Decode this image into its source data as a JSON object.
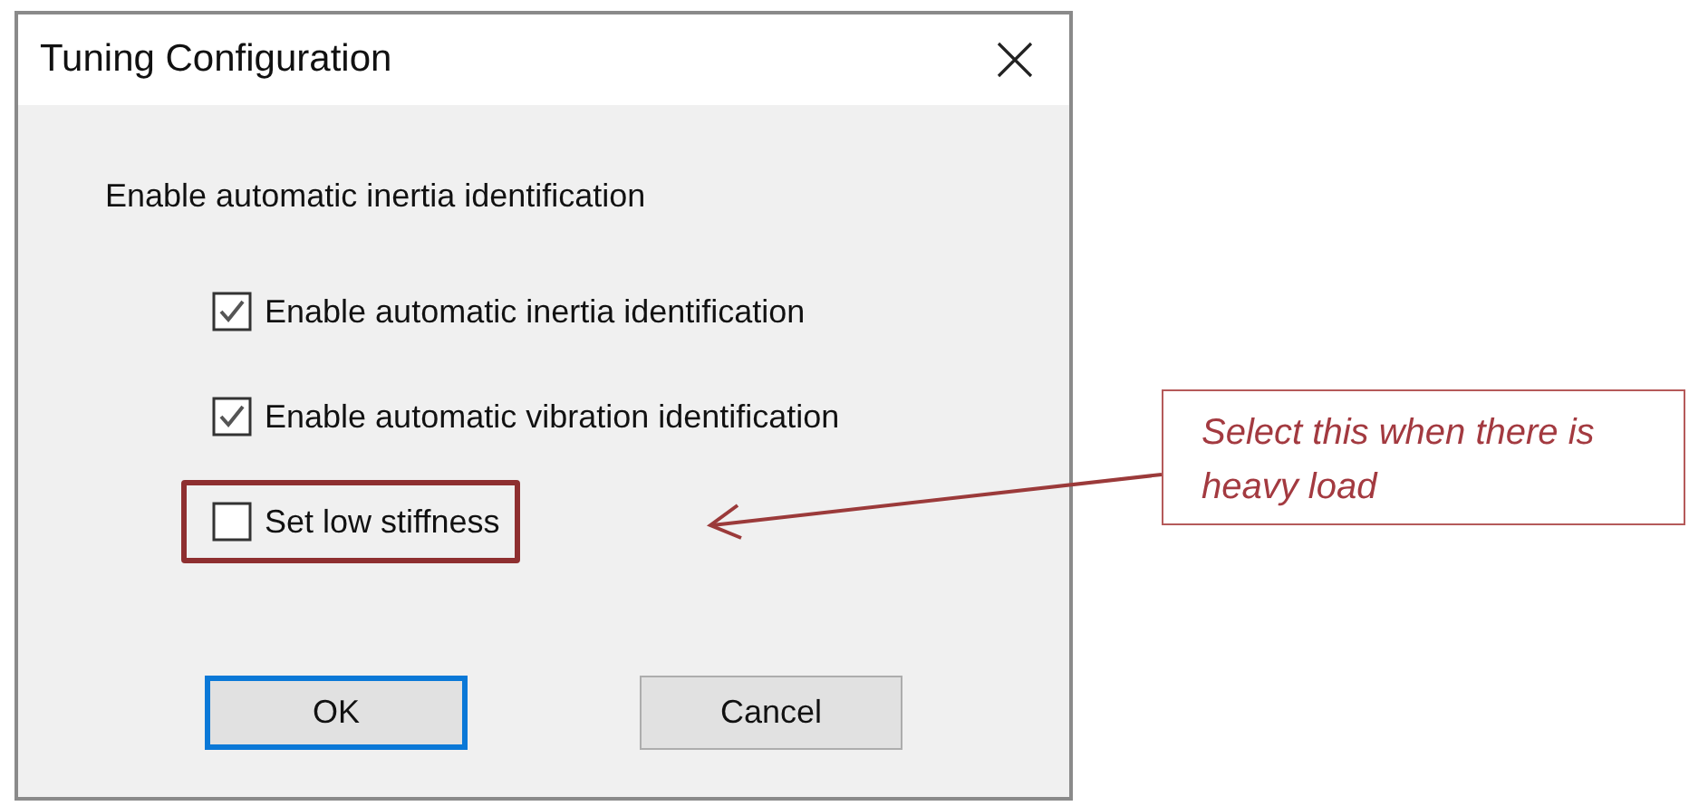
{
  "window": {
    "title": "Tuning Configuration"
  },
  "heading": "Enable automatic inertia identification",
  "options": [
    {
      "label": "Enable automatic inertia identification",
      "checked": true,
      "highlighted": false
    },
    {
      "label": "Enable automatic vibration identification",
      "checked": true,
      "highlighted": false
    },
    {
      "label": "Set low stiffness",
      "checked": false,
      "highlighted": true
    }
  ],
  "buttons": [
    {
      "label": "OK",
      "default": true
    },
    {
      "label": "Cancel",
      "default": false
    }
  ],
  "annotation": {
    "text": "Select this when there is heavy load"
  }
}
